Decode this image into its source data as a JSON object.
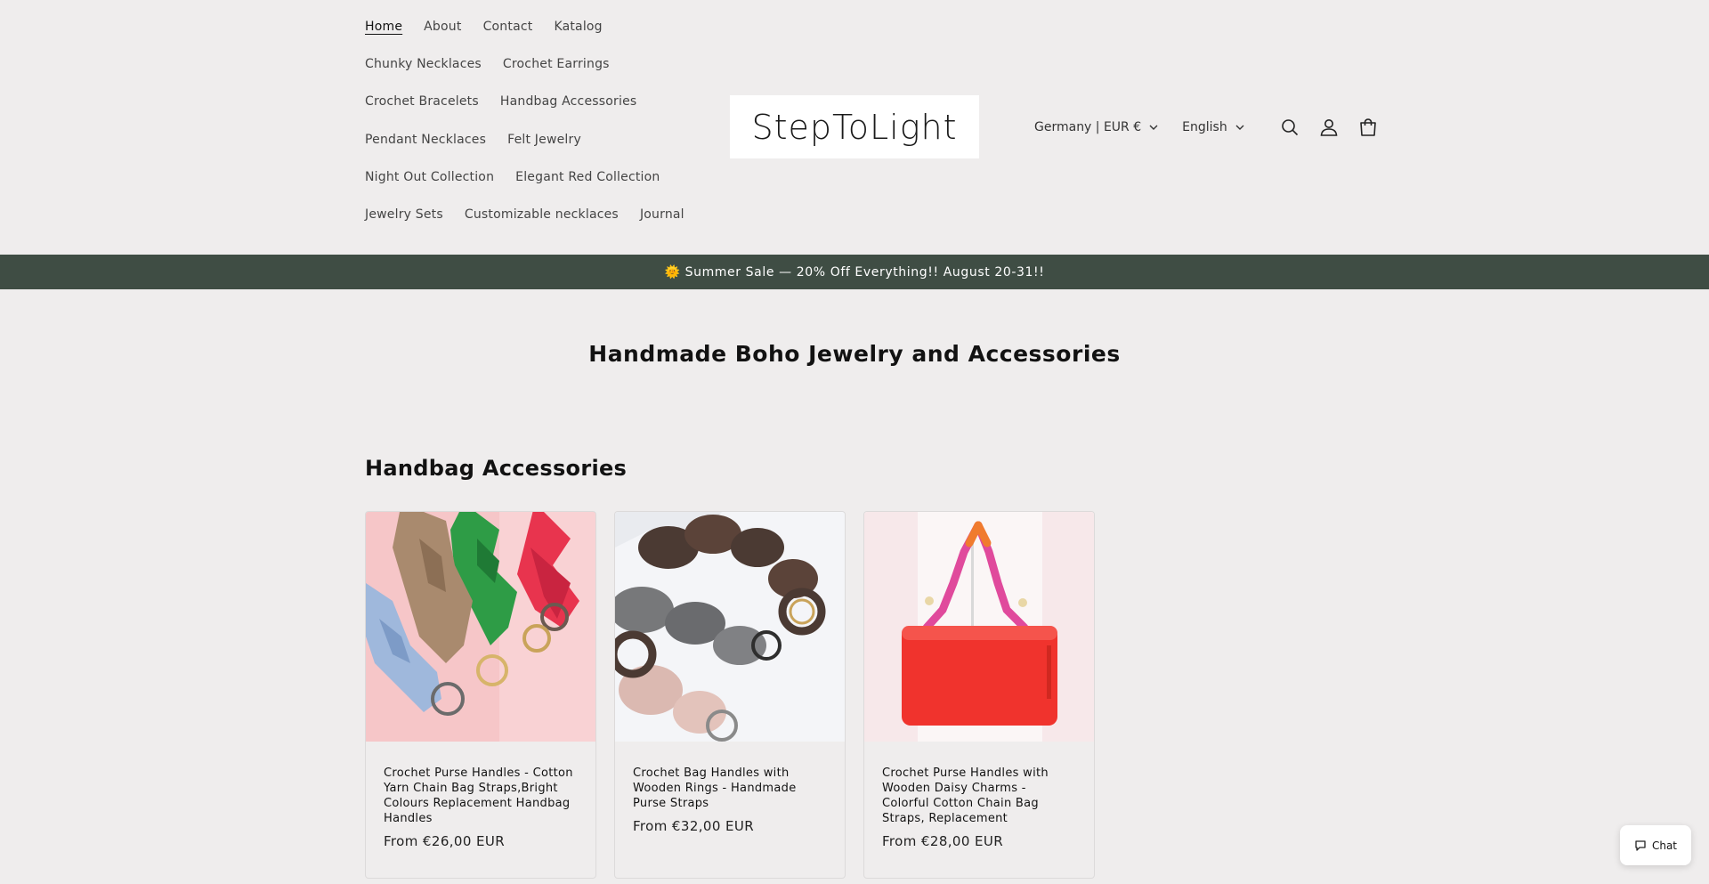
{
  "nav": {
    "rows": [
      [
        "Home",
        "About",
        "Contact",
        "Katalog"
      ],
      [
        "Chunky Necklaces",
        "Crochet Earrings"
      ],
      [
        "Crochet Bracelets",
        "Handbag Accessories"
      ],
      [
        "Pendant Necklaces",
        "Felt Jewelry"
      ],
      [
        "Night Out Collection",
        "Elegant Red Collection"
      ],
      [
        "Jewelry Sets",
        "Customizable necklaces",
        "Journal"
      ]
    ],
    "active": "Home"
  },
  "logo": {
    "text": "StepToLight"
  },
  "header": {
    "country_selector": "Germany | EUR €",
    "language_selector": "English",
    "icons": [
      "search-icon",
      "account-icon",
      "cart-icon"
    ]
  },
  "announcement": {
    "text": "🌞 Summer Sale — 20% Off Everything!! August 20-31!!",
    "background": "#3f4d44"
  },
  "main": {
    "hero_title": "Handmade Boho Jewelry and Accessories",
    "section_title": "Handbag Accessories",
    "products": [
      {
        "title": "Crochet Purse Handles - Cotton Yarn Chain Bag Straps,Bright Colours Replacement Handbag Handles",
        "price": "From €26,00 EUR"
      },
      {
        "title": "Crochet Bag Handles with Wooden Rings - Handmade Purse Straps",
        "price": "From €32,00 EUR"
      },
      {
        "title": "Crochet Purse Handles with Wooden Daisy Charms - Colorful Cotton Chain Bag Straps, Replacement",
        "price": "From €28,00 EUR"
      }
    ]
  },
  "chat": {
    "label": "Chat"
  }
}
